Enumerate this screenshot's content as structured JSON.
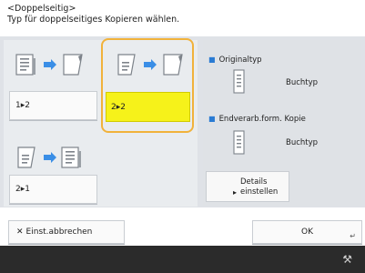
{
  "header": {
    "line1": "<Doppelseitig>",
    "line2": "Typ für doppelseitiges Kopieren wählen."
  },
  "modes": [
    {
      "label": "1▸2",
      "selected": false
    },
    {
      "label": "2▸2",
      "selected": true
    },
    {
      "label": "2▸1",
      "selected": false
    }
  ],
  "original_type": {
    "title": "Originaltyp",
    "value": "Buchtyp"
  },
  "finished_copy": {
    "title": "Endverarb.form. Kopie",
    "value": "Buchtyp"
  },
  "details_button": {
    "line1": "Details",
    "line2": "einstellen"
  },
  "bottom": {
    "cancel_label": "Einst.abbrechen",
    "ok_label": "OK"
  },
  "colors": {
    "accent_selected": "#f6f21a",
    "selection_frame": "#f1b23b",
    "bullet": "#2a7bd3"
  },
  "icons": {
    "cancel": "x-icon",
    "ok_corner": "return-arrow-icon",
    "footer": "tool-icon"
  }
}
